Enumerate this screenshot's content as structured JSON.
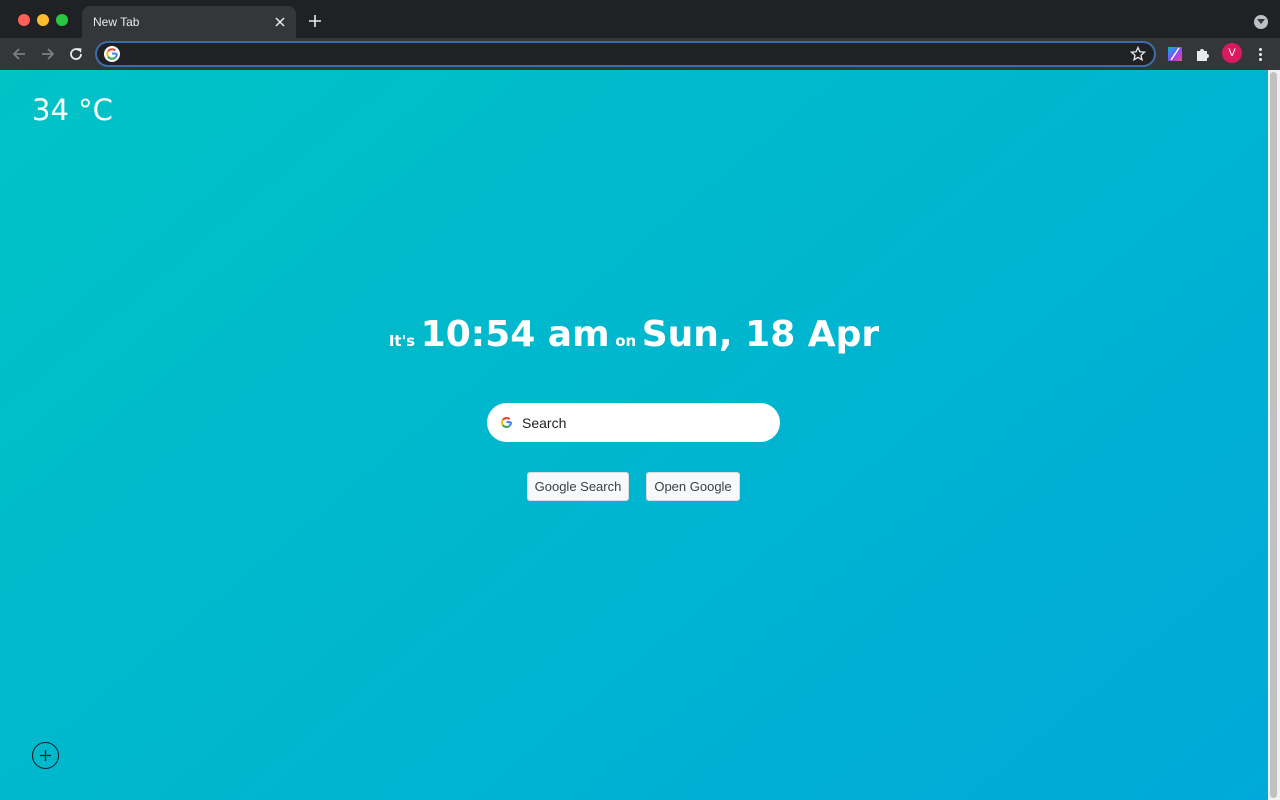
{
  "browser": {
    "tab_title": "New Tab",
    "address_value": "",
    "profile_initial": "V"
  },
  "page": {
    "weather": "34 °C",
    "clock": {
      "prefix": "It's",
      "time": "10:54 am",
      "connector": "on",
      "date": "Sun, 18 Apr"
    },
    "search": {
      "placeholder": "Search"
    },
    "buttons": {
      "google_search": "Google Search",
      "open_google": "Open Google"
    }
  },
  "colors": {
    "gradient_start": "#00c3c6",
    "gradient_end": "#00a9d9",
    "avatar": "#d81b60"
  }
}
